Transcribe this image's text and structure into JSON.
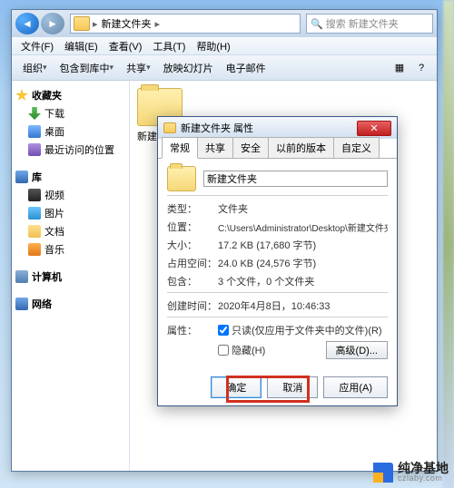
{
  "explorer": {
    "breadcrumb": {
      "folder": "新建文件夹"
    },
    "search_placeholder": "搜索 新建文件夹",
    "menus": {
      "file": "文件(F)",
      "edit": "编辑(E)",
      "view": "查看(V)",
      "tools": "工具(T)",
      "help": "帮助(H)"
    },
    "toolbar": {
      "organize": "组织",
      "include": "包含到库中",
      "share": "共享",
      "slideshow": "放映幻灯片",
      "email": "电子邮件"
    },
    "content": {
      "folder_name": "新建"
    }
  },
  "sidebar": {
    "favorites": {
      "head": "收藏夹",
      "items": [
        "下载",
        "桌面",
        "最近访问的位置"
      ]
    },
    "libraries": {
      "head": "库",
      "items": [
        "视频",
        "图片",
        "文档",
        "音乐"
      ]
    },
    "computer": {
      "head": "计算机"
    },
    "network": {
      "head": "网络"
    }
  },
  "dialog": {
    "title": "新建文件夹 属性",
    "tabs": {
      "general": "常规",
      "share": "共享",
      "security": "安全",
      "previous": "以前的版本",
      "custom": "自定义"
    },
    "name_value": "新建文件夹",
    "rows": {
      "type_lbl": "类型：",
      "type_val": "文件夹",
      "loc_lbl": "位置：",
      "loc_val": "C:\\Users\\Administrator\\Desktop\\新建文件夹",
      "size_lbl": "大小：",
      "size_val": "17.2 KB (17,680 字节)",
      "disk_lbl": "占用空间：",
      "disk_val": "24.0 KB (24,576 字节)",
      "contains_lbl": "包含：",
      "contains_val": "3 个文件，0 个文件夹",
      "created_lbl": "创建时间：",
      "created_val": "2020年4月8日，10:46:33",
      "attr_lbl": "属性：",
      "readonly": "只读(仅应用于文件夹中的文件)(R)",
      "hidden": "隐藏(H)",
      "advanced": "高级(D)..."
    },
    "buttons": {
      "ok": "确定",
      "cancel": "取消",
      "apply": "应用(A)"
    }
  },
  "watermark": {
    "name": "纯净基地",
    "domain": "czlaby.com"
  }
}
